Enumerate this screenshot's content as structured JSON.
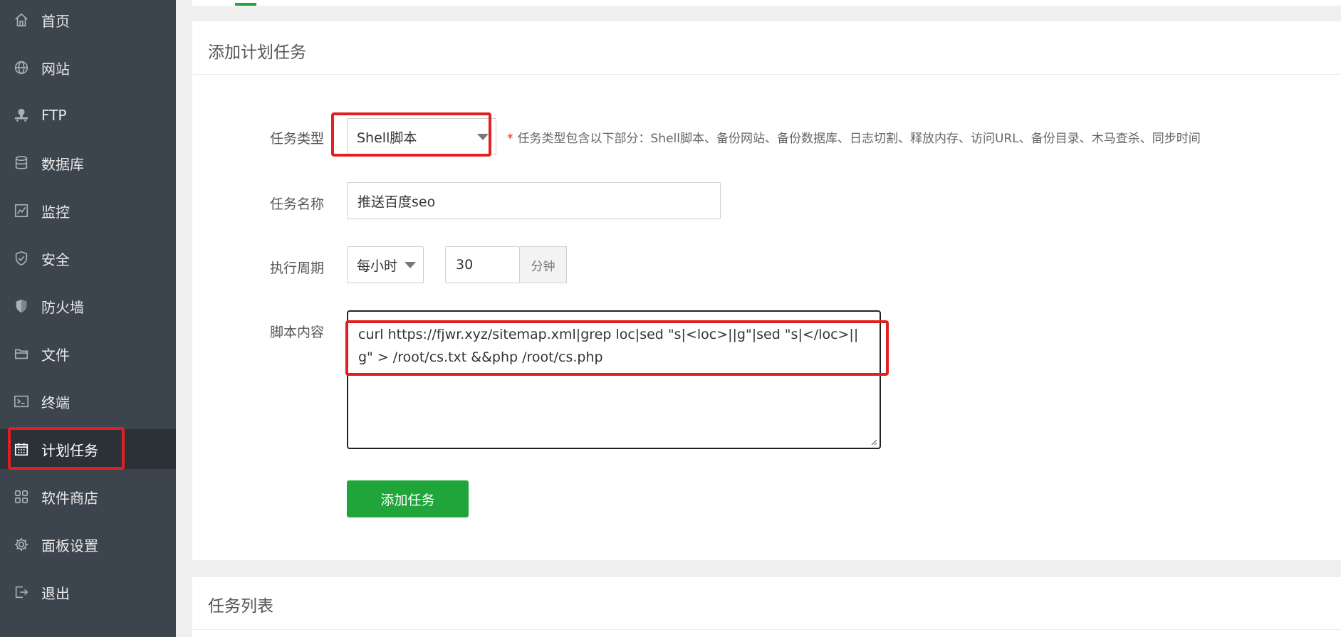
{
  "sidebar": {
    "items": [
      {
        "label": "首页",
        "icon": "home-icon"
      },
      {
        "label": "网站",
        "icon": "globe-icon"
      },
      {
        "label": "FTP",
        "icon": "ftp-icon"
      },
      {
        "label": "数据库",
        "icon": "database-icon"
      },
      {
        "label": "监控",
        "icon": "monitor-icon"
      },
      {
        "label": "安全",
        "icon": "shield-icon"
      },
      {
        "label": "防火墙",
        "icon": "firewall-icon"
      },
      {
        "label": "文件",
        "icon": "folder-icon"
      },
      {
        "label": "终端",
        "icon": "terminal-icon"
      },
      {
        "label": "计划任务",
        "icon": "calendar-icon"
      },
      {
        "label": "软件商店",
        "icon": "grid-icon"
      },
      {
        "label": "面板设置",
        "icon": "gear-icon"
      },
      {
        "label": "退出",
        "icon": "logout-icon"
      }
    ],
    "active": "计划任务"
  },
  "add_task": {
    "title": "添加计划任务",
    "task_type": {
      "label": "任务类型",
      "value": "Shell脚本",
      "hint": "任务类型包含以下部分：Shell脚本、备份网站、备份数据库、日志切割、释放内存、访问URL、备份目录、木马查杀、同步时间"
    },
    "task_name": {
      "label": "任务名称",
      "value": "推送百度seo"
    },
    "period": {
      "label": "执行周期",
      "unit_select": "每小时",
      "minutes": "30",
      "minutes_unit": "分钟"
    },
    "script": {
      "label": "脚本内容",
      "value": "curl https://fjwr.xyz/sitemap.xml|grep loc|sed \"s|<loc>||g\"|sed \"s|</loc>||g\" > /root/cs.txt &&php /root/cs.php"
    },
    "submit_label": "添加任务"
  },
  "task_list": {
    "title": "任务列表"
  },
  "colors": {
    "sidebar_bg": "#3c444d",
    "accent": "#20a53a",
    "highlight": "#e02020"
  }
}
